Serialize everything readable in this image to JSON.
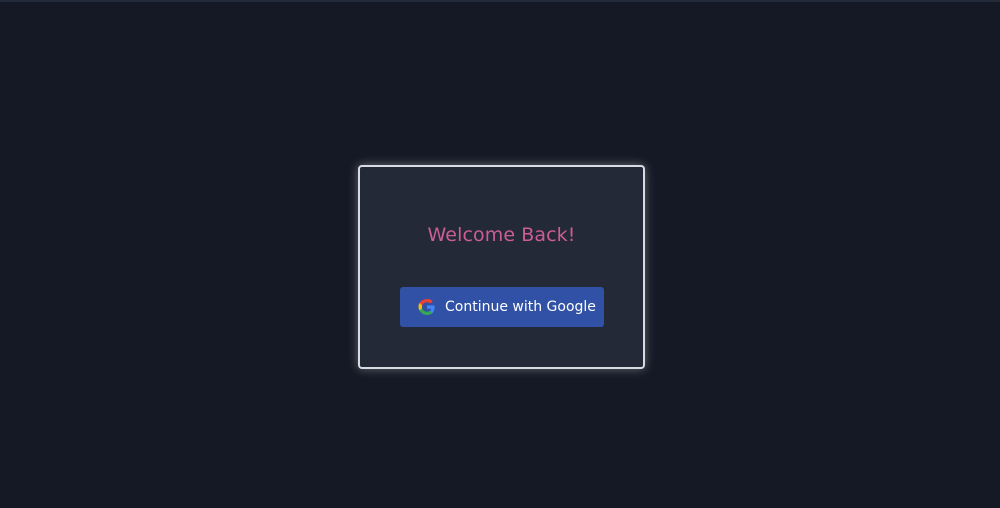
{
  "login_card": {
    "heading": "Welcome Back!",
    "google_button_label": "Continue with Google"
  },
  "icons": {
    "google_icon": "google-icon"
  },
  "colors": {
    "background": "#151925",
    "card_background": "#232936",
    "card_border": "#d9dbe2",
    "heading": "#cc5d95",
    "button": "#3151a6",
    "button_text": "#ffffff"
  }
}
